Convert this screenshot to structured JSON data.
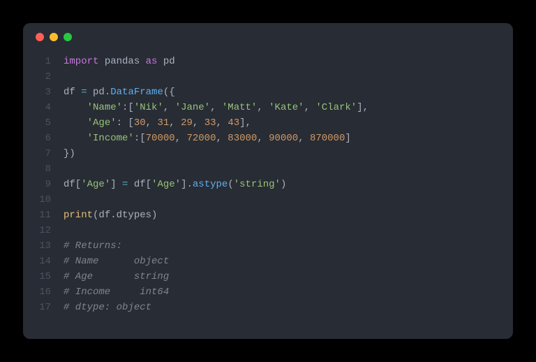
{
  "code": {
    "line1": {
      "import": "import",
      "pandas": " pandas ",
      "as": "as",
      "pd": " pd"
    },
    "line3": {
      "df": "df ",
      "eq": "=",
      "pd": " pd.",
      "DataFrame": "DataFrame",
      "open": "({"
    },
    "line4": {
      "indent": "    ",
      "key": "'Name'",
      "colon": ":[",
      "v1": "'Nik'",
      "c1": ", ",
      "v2": "'Jane'",
      "c2": ", ",
      "v3": "'Matt'",
      "c3": ", ",
      "v4": "'Kate'",
      "c4": ", ",
      "v5": "'Clark'",
      "close": "],"
    },
    "line5": {
      "indent": "    ",
      "key": "'Age'",
      "colon": ": [",
      "v1": "30",
      "c1": ", ",
      "v2": "31",
      "c2": ", ",
      "v3": "29",
      "c3": ", ",
      "v4": "33",
      "c4": ", ",
      "v5": "43",
      "close": "],"
    },
    "line6": {
      "indent": "    ",
      "key": "'Income'",
      "colon": ":[",
      "v1": "70000",
      "c1": ", ",
      "v2": "72000",
      "c2": ", ",
      "v3": "83000",
      "c3": ", ",
      "v4": "90000",
      "c4": ", ",
      "v5": "870000",
      "close": "]"
    },
    "line7": {
      "close": "})"
    },
    "line9": {
      "df1": "df[",
      "age1": "'Age'",
      "mid": "] ",
      "eq": "=",
      "df2": " df[",
      "age2": "'Age'",
      "mid2": "].",
      "astype": "astype",
      "open": "(",
      "string": "'string'",
      "close": ")"
    },
    "line11": {
      "print": "print",
      "open": "(df.dtypes)"
    },
    "line13": "# Returns:",
    "line14": "# Name      object",
    "line15": "# Age       string",
    "line16": "# Income     int64",
    "line17": "# dtype: object"
  },
  "gutters": {
    "g1": "1",
    "g2": "2",
    "g3": "3",
    "g4": "4",
    "g5": "5",
    "g6": "6",
    "g7": "7",
    "g8": "8",
    "g9": "9",
    "g10": "10",
    "g11": "11",
    "g12": "12",
    "g13": "13",
    "g14": "14",
    "g15": "15",
    "g16": "16",
    "g17": "17"
  }
}
